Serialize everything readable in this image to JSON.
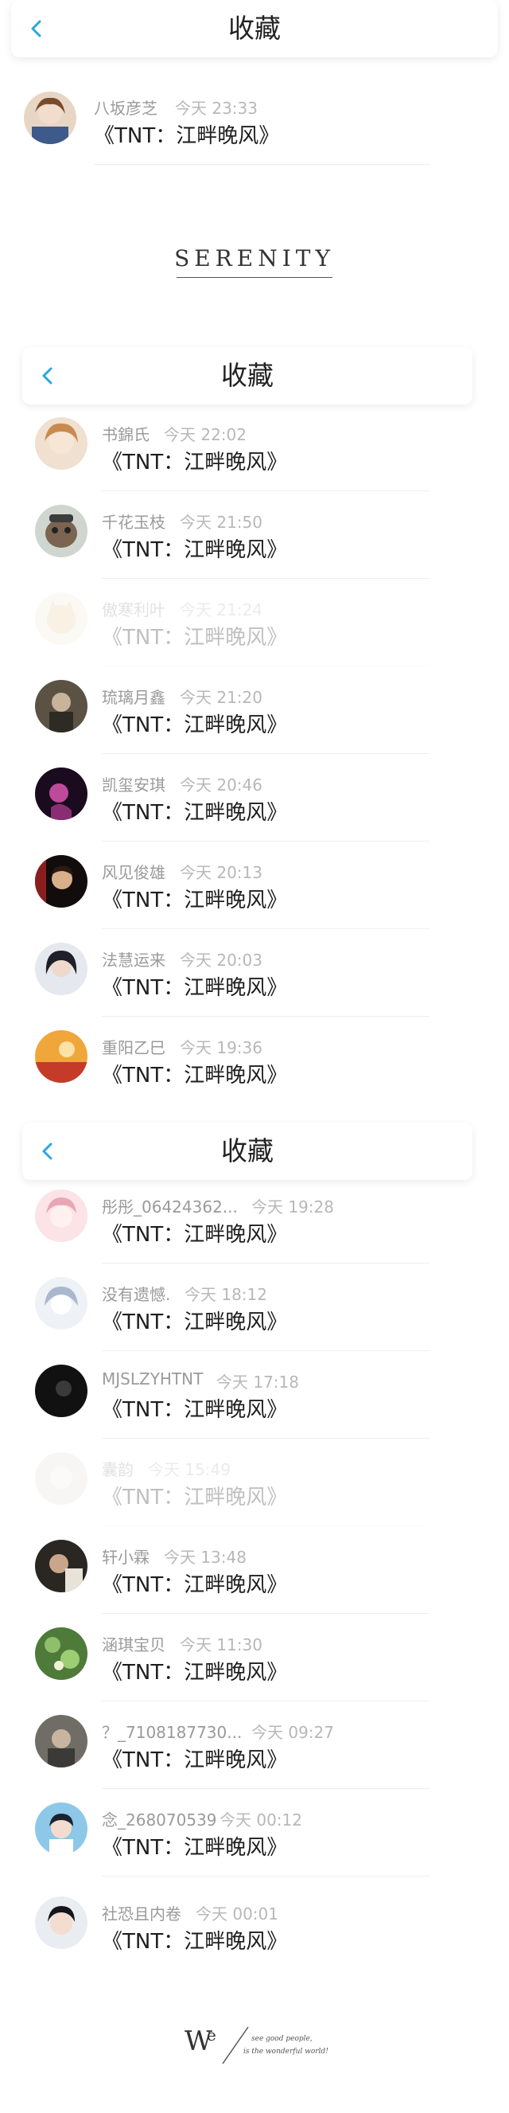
{
  "header": {
    "title": "收藏",
    "back_icon": "chevron-left-icon"
  },
  "brand": {
    "serenity": "SERENITY"
  },
  "footer": {
    "we": "W",
    "we_sup": "e",
    "line1": "see good people,",
    "line2": "is the wonderful world!"
  },
  "colors": {
    "accent": "#2aa6de",
    "name": "#9a9a9a",
    "time": "#b8b8b8",
    "text": "#1e1e1e"
  },
  "sections": [
    {
      "items": [
        {
          "name": "八坂彦芝",
          "time": "今天 23:33",
          "book": "《TNT：江畔晚风》"
        }
      ]
    },
    {
      "items": [
        {
          "name": "书錦氏",
          "time": "今天 22:02",
          "book": "《TNT：江畔晚风》"
        },
        {
          "name": "千花玉枝",
          "time": "今天 21:50",
          "book": "《TNT：江畔晚风》"
        },
        {
          "name": "傲寒利叶",
          "time": "今天 21:24",
          "book": "《TNT：江畔晚风》"
        },
        {
          "name": "琉璃月鑫",
          "time": "今天 21:20",
          "book": "《TNT：江畔晚风》"
        },
        {
          "name": "凯玺安琪",
          "time": "今天 20:46",
          "book": "《TNT：江畔晚风》"
        },
        {
          "name": "风见俊雄",
          "time": "今天 20:13",
          "book": "《TNT：江畔晚风》"
        },
        {
          "name": "法慧运来",
          "time": "今天 20:03",
          "book": "《TNT：江畔晚风》"
        },
        {
          "name": "重阳乙巳",
          "time": "今天 19:36",
          "book": "《TNT：江畔晚风》"
        }
      ]
    },
    {
      "items": [
        {
          "name": "彤彤_06424362...",
          "time": "今天 19:28",
          "book": "《TNT：江畔晚风》"
        },
        {
          "name": "没有遗憾.",
          "time": "今天 18:12",
          "book": "《TNT：江畔晚风》"
        },
        {
          "name": "MJSLZYHTNT",
          "time": "今天 17:18",
          "book": "《TNT：江畔晚风》"
        },
        {
          "name": "囊韵",
          "time": "今天 15:49",
          "book": "《TNT：江畔晚风》"
        },
        {
          "name": "轩小霖",
          "time": "今天 13:48",
          "book": "《TNT：江畔晚风》"
        },
        {
          "name": "涵琪宝贝",
          "time": "今天 11:30",
          "book": "《TNT：江畔晚风》"
        },
        {
          "name": "？_7108187730...",
          "time": "今天 09:27",
          "book": "《TNT：江畔晚风》"
        },
        {
          "name": "念_268070539",
          "time": "今天 00:12",
          "book": "《TNT：江畔晚风》"
        },
        {
          "name": "社恐且内卷",
          "time": "今天 00:01",
          "book": "《TNT：江畔晚风》"
        }
      ]
    }
  ]
}
